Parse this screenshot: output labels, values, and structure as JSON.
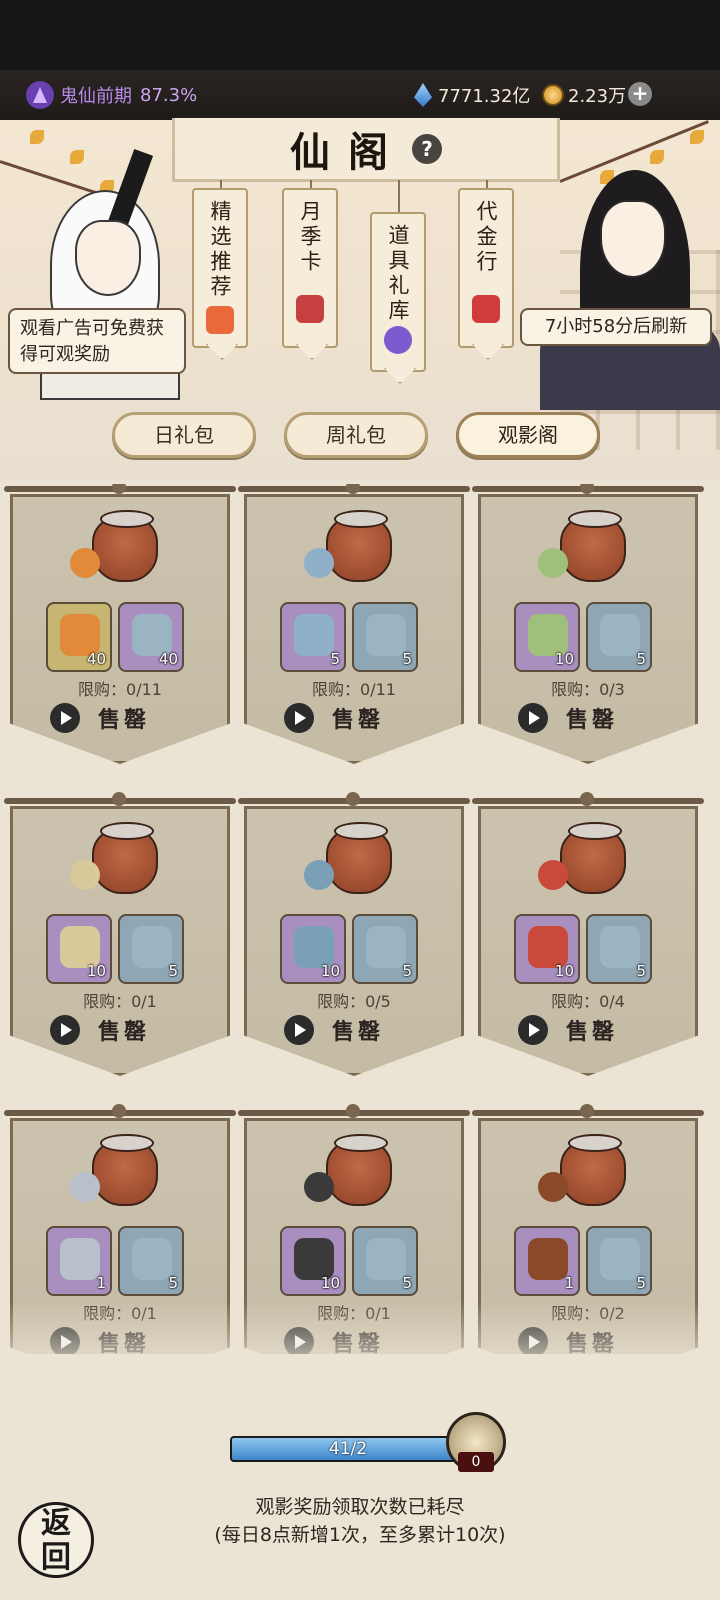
{
  "status": {
    "realm_name": "鬼仙前期",
    "realm_progress": "87.3%",
    "spirit_stones": "7771.32亿",
    "gold": "2.23万",
    "plus_icon": "plus-icon"
  },
  "header": {
    "title": "仙阁",
    "help_icon": "question-icon"
  },
  "speech": {
    "left": "观看广告可免费获得可观奖励",
    "right": "7小时58分后刷新"
  },
  "banners": [
    {
      "label": "精选推荐"
    },
    {
      "label": "月季卡"
    },
    {
      "label": "道具礼库"
    },
    {
      "label": "代金行"
    }
  ],
  "tabs": [
    {
      "label": "日礼包"
    },
    {
      "label": "周礼包"
    },
    {
      "label": "观影阁"
    }
  ],
  "active_tab": "观影阁",
  "products": [
    {
      "items": [
        {
          "color": "gold",
          "count": "40"
        },
        {
          "color": "purple",
          "count": "40"
        }
      ],
      "limit": "限购：0/11",
      "status": "售罄"
    },
    {
      "items": [
        {
          "color": "purple",
          "count": "5"
        },
        {
          "color": "blue",
          "count": "5"
        }
      ],
      "limit": "限购：0/11",
      "status": "售罄"
    },
    {
      "items": [
        {
          "color": "purple",
          "count": "10"
        },
        {
          "color": "blue",
          "count": "5"
        }
      ],
      "limit": "限购：0/3",
      "status": "售罄"
    },
    {
      "items": [
        {
          "color": "purple",
          "count": "10"
        },
        {
          "color": "blue",
          "count": "5"
        }
      ],
      "limit": "限购：0/1",
      "status": "售罄"
    },
    {
      "items": [
        {
          "color": "purple",
          "count": "10"
        },
        {
          "color": "blue",
          "count": "5"
        }
      ],
      "limit": "限购：0/5",
      "status": "售罄"
    },
    {
      "items": [
        {
          "color": "purple",
          "count": "10"
        },
        {
          "color": "blue",
          "count": "5"
        }
      ],
      "limit": "限购：0/4",
      "status": "售罄"
    },
    {
      "items": [
        {
          "color": "purple",
          "count": "1"
        },
        {
          "color": "blue",
          "count": "5"
        }
      ],
      "limit": "限购：0/1",
      "status": "售罄"
    },
    {
      "items": [
        {
          "color": "purple",
          "count": "10"
        },
        {
          "color": "blue",
          "count": "5"
        }
      ],
      "limit": "限购：0/1",
      "status": "售罄"
    },
    {
      "items": [
        {
          "color": "purple",
          "count": "1"
        },
        {
          "color": "blue",
          "count": "5"
        }
      ],
      "limit": "限购：0/2",
      "status": "售罄"
    }
  ],
  "progress": {
    "text": "41/2",
    "fill_fraction": 1.0,
    "reward_count": "0"
  },
  "messages": {
    "line1": "观影奖励领取次数已耗尽",
    "line2": "(每日8点新增1次，至多累计10次)"
  },
  "back_button": {
    "label_top": "返",
    "label_bottom": "回"
  },
  "colors": {
    "slot_purple": "#a98fbf",
    "slot_blue": "#8fa6b5",
    "slot_gold": "#c7b672",
    "progress_fill": "#3d86c9"
  }
}
